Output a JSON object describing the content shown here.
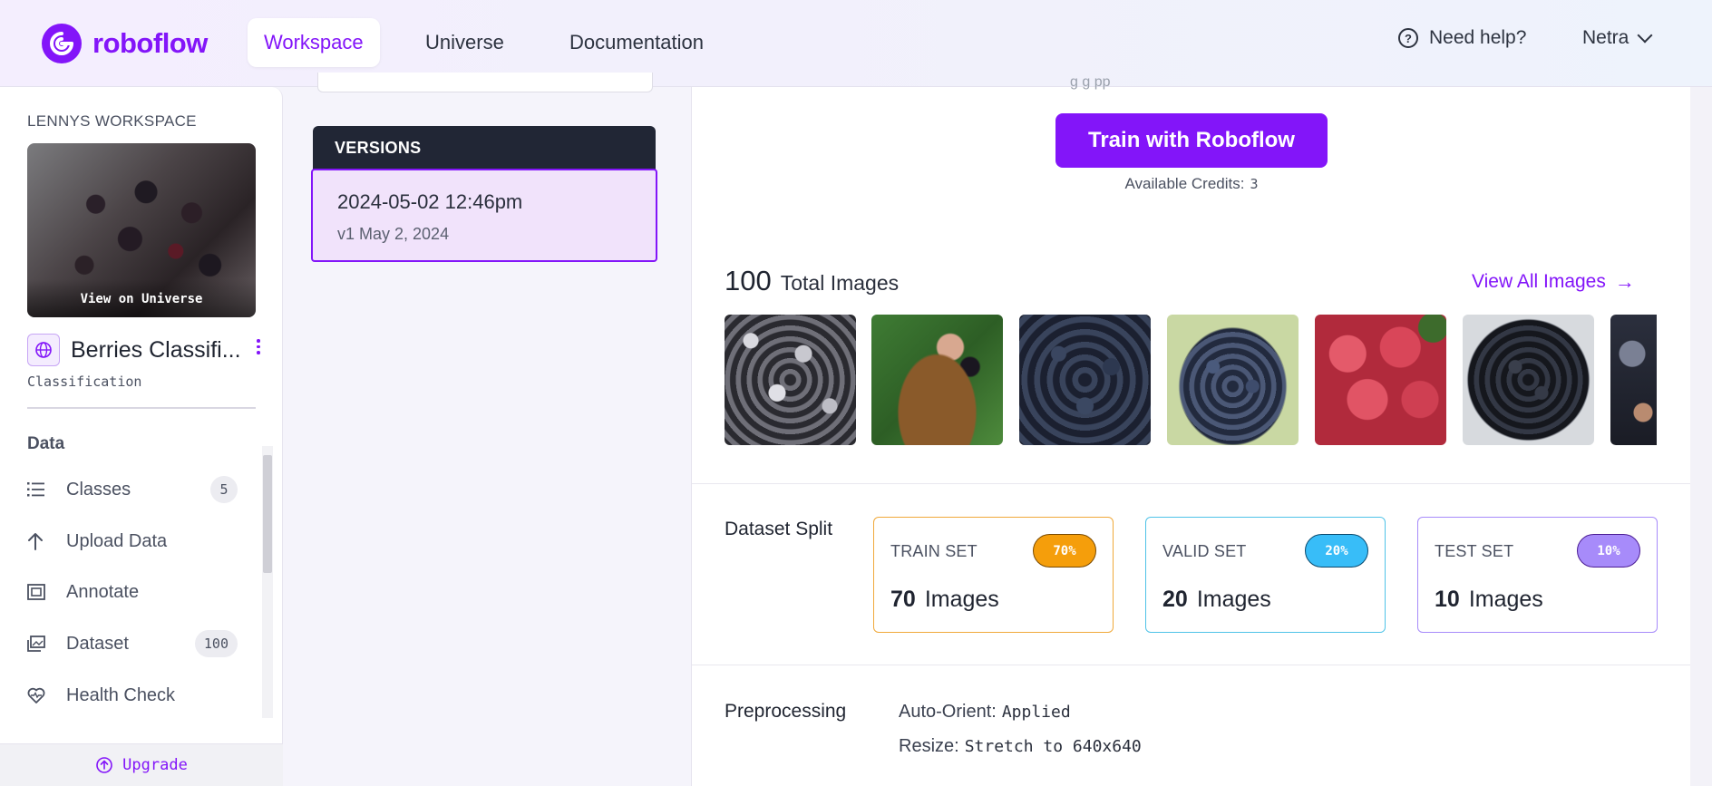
{
  "nav": {
    "logo_text": "roboflow",
    "tabs": [
      {
        "label": "Workspace",
        "active": true
      },
      {
        "label": "Universe",
        "active": false
      },
      {
        "label": "Documentation",
        "active": false
      }
    ],
    "help_label": "Need help?",
    "user_name": "Netra"
  },
  "sidebar": {
    "workspace_label": "LENNYS WORKSPACE",
    "thumb_overlay": "View on Universe",
    "project_name": "Berries Classifi...",
    "project_type": "Classification",
    "section_label": "Data",
    "items": [
      {
        "label": "Classes",
        "icon": "list-icon",
        "badge": "5"
      },
      {
        "label": "Upload Data",
        "icon": "upload-arrow-icon",
        "badge": ""
      },
      {
        "label": "Annotate",
        "icon": "annotate-icon",
        "badge": ""
      },
      {
        "label": "Dataset",
        "icon": "images-stack-icon",
        "badge": "100"
      },
      {
        "label": "Health Check",
        "icon": "heart-pulse-icon",
        "badge": ""
      }
    ],
    "upgrade_label": "Upgrade"
  },
  "versions": {
    "header": "VERSIONS",
    "items": [
      {
        "title": "2024-05-02 12:46pm",
        "subtitle": "v1 May 2, 2024",
        "selected": true
      }
    ]
  },
  "main": {
    "cut_text": "g                g                  pp",
    "train_button": "Train with Roboflow",
    "credits_label": "Available Credits:",
    "credits_value": "3",
    "total_images_num": "100",
    "total_images_label": "Total Images",
    "view_all_label": "View All Images",
    "dataset_split_label": "Dataset Split",
    "splits": [
      {
        "name": "TRAIN SET",
        "percent": "70%",
        "count": "70",
        "unit": "Images",
        "color": "#f59e0b"
      },
      {
        "name": "VALID SET",
        "percent": "20%",
        "count": "20",
        "unit": "Images",
        "color": "#38bdf8"
      },
      {
        "name": "TEST SET",
        "percent": "10%",
        "count": "10",
        "unit": "Images",
        "color": "#a78bfa"
      }
    ],
    "preprocessing_label": "Preprocessing",
    "preprocessing": [
      {
        "key": "Auto-Orient:",
        "value": "Applied"
      },
      {
        "key": "Resize:",
        "value": "Stretch to 640x640"
      }
    ]
  },
  "colors": {
    "accent": "#8315f9",
    "versions_header_bg": "#212635",
    "selected_version_bg": "#f1e3fb"
  }
}
